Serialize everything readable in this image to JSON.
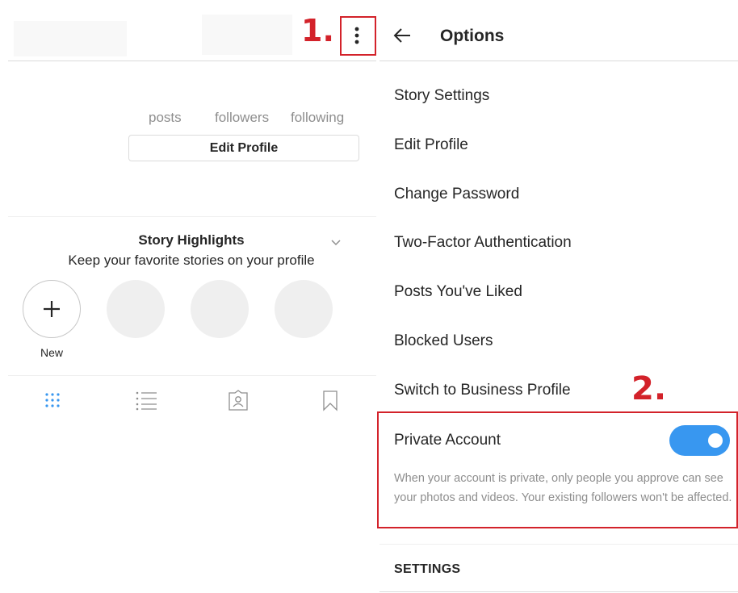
{
  "profile": {
    "stats": {
      "posts_label": "posts",
      "followers_label": "followers",
      "following_label": "following"
    },
    "edit_profile_label": "Edit Profile",
    "highlights": {
      "title": "Story Highlights",
      "subtitle": "Keep your favorite stories on your profile",
      "new_label": "New"
    },
    "tabs": [
      "grid-icon",
      "list-icon",
      "tagged-icon",
      "saved-icon"
    ],
    "active_tab_color": "#3897f0"
  },
  "annotations": {
    "step1": "1.",
    "step2": "2.",
    "color": "#d3222a"
  },
  "options": {
    "title": "Options",
    "items": [
      "Story Settings",
      "Edit Profile",
      "Change Password",
      "Two-Factor Authentication",
      "Posts You've Liked",
      "Blocked Users",
      "Switch to Business Profile"
    ],
    "private_account": {
      "label": "Private Account",
      "enabled": true,
      "description": "When your account is private, only people you approve can see your photos and videos. Your existing followers won't be affected."
    },
    "section_header": "SETTINGS",
    "toggle_color": "#3897f0"
  }
}
